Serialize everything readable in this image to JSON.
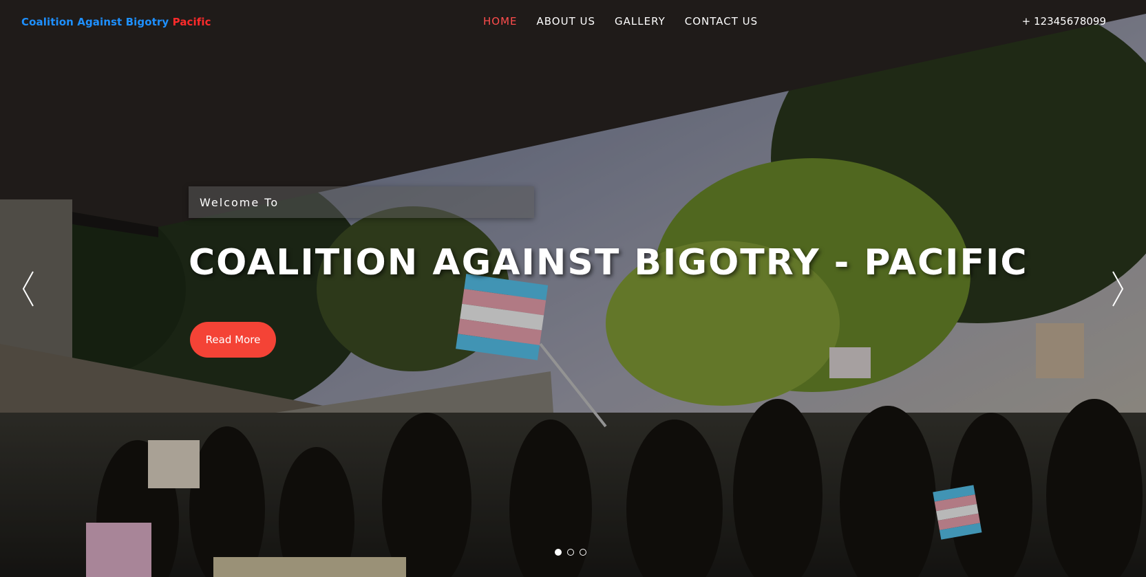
{
  "header": {
    "logo_part1": "Coalition Against Bigotry",
    "logo_part2": "Pacific",
    "nav": [
      {
        "label": "HOME",
        "active": true
      },
      {
        "label": "ABOUT US",
        "active": false
      },
      {
        "label": "GALLERY",
        "active": false
      },
      {
        "label": "CONTACT US",
        "active": false
      }
    ],
    "phone": "+ 12345678099"
  },
  "hero": {
    "welcome": "Welcome To",
    "title": "COALITION AGAINST BIGOTRY - PACIFIC",
    "cta_label": "Read More"
  },
  "carousel": {
    "slide_count": 3,
    "active_index": 0,
    "prev_icon": "chevron-left-icon",
    "next_icon": "chevron-right-icon"
  },
  "colors": {
    "logo_blue": "#1e90ff",
    "logo_red": "#ff2b2b",
    "nav_active": "#ff4d4d",
    "cta": "#f44336"
  }
}
